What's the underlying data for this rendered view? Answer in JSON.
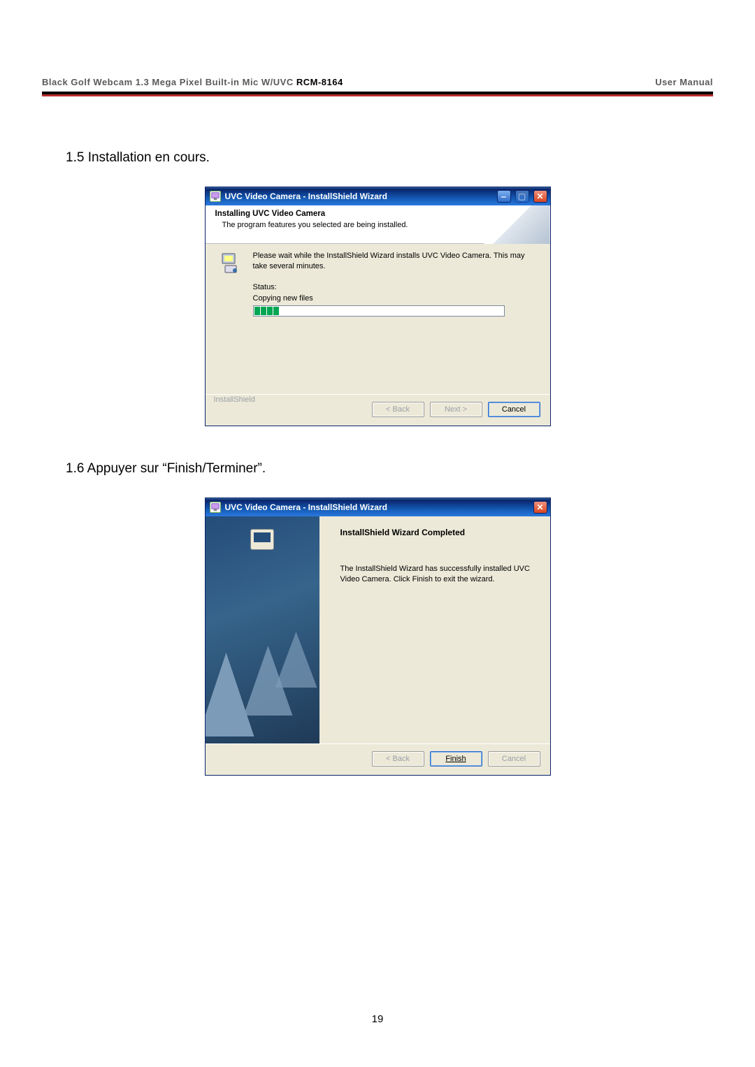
{
  "header": {
    "left_prefix": "Black  Golf  Webcam 1.3  Mega  Pixel  Built-in  Mic  W/UVC ",
    "model": "RCM-8164",
    "right": "User  Manual"
  },
  "section_1_5": "1.5 Installation en cours.",
  "section_1_6": "1.6 Appuyer sur “Finish/Terminer”.",
  "dialog1": {
    "title": "UVC Video Camera - InstallShield Wizard",
    "heading": "Installing UVC Video Camera",
    "subheading": "The program features you selected are being installed.",
    "body": "Please wait while the InstallShield Wizard installs UVC Video Camera. This may take several minutes.",
    "status_label": "Status:",
    "status_value": "Copying new files",
    "brand": "InstallShield",
    "back": "< Back",
    "next": "Next >",
    "cancel": "Cancel"
  },
  "dialog2": {
    "title": "UVC Video Camera - InstallShield Wizard",
    "heading": "InstallShield Wizard Completed",
    "body": "The InstallShield Wizard has successfully installed UVC Video Camera. Click Finish to exit the wizard.",
    "back": "< Back",
    "finish": "Finish",
    "cancel": "Cancel"
  },
  "page_number": "19"
}
